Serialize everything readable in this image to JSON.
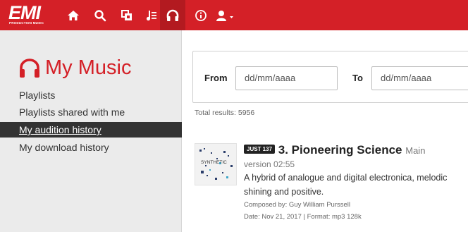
{
  "header": {
    "logo_text": "EMI",
    "logo_subtext": "PRODUCTION MUSIC",
    "nav_icons": [
      "home-icon",
      "search-icon",
      "collections-icon",
      "playlist-icon",
      "headphones-icon",
      "info-icon",
      "user-icon"
    ],
    "active_icon": "headphones-icon",
    "colors": {
      "brand": "#d42027",
      "active": "#b31a20"
    }
  },
  "sidebar": {
    "title": "My Music",
    "items": [
      {
        "label": "Playlists"
      },
      {
        "label": "Playlists shared with me"
      },
      {
        "label": "My audition history"
      },
      {
        "label": "My download history"
      }
    ],
    "active_index": 2
  },
  "filter": {
    "from_label": "From",
    "from_placeholder": "dd/mm/aaaa",
    "to_label": "To",
    "to_placeholder": "dd/mm/aaaa"
  },
  "results_text": "Total results: 5956",
  "track": {
    "badge": "JUST 137",
    "title": "3. Pioneering Science",
    "version_label": "Main",
    "version_line": "version 02:55",
    "description_line1": "A hybrid of analogue and digital electronica, melodic",
    "description_line2": "shining and positive.",
    "composer": "Composed by: Guy William Purssell",
    "date_format": "Date: Nov 21, 2017 | Format: mp3 128k",
    "cover_text": "SYNTHETIC"
  }
}
